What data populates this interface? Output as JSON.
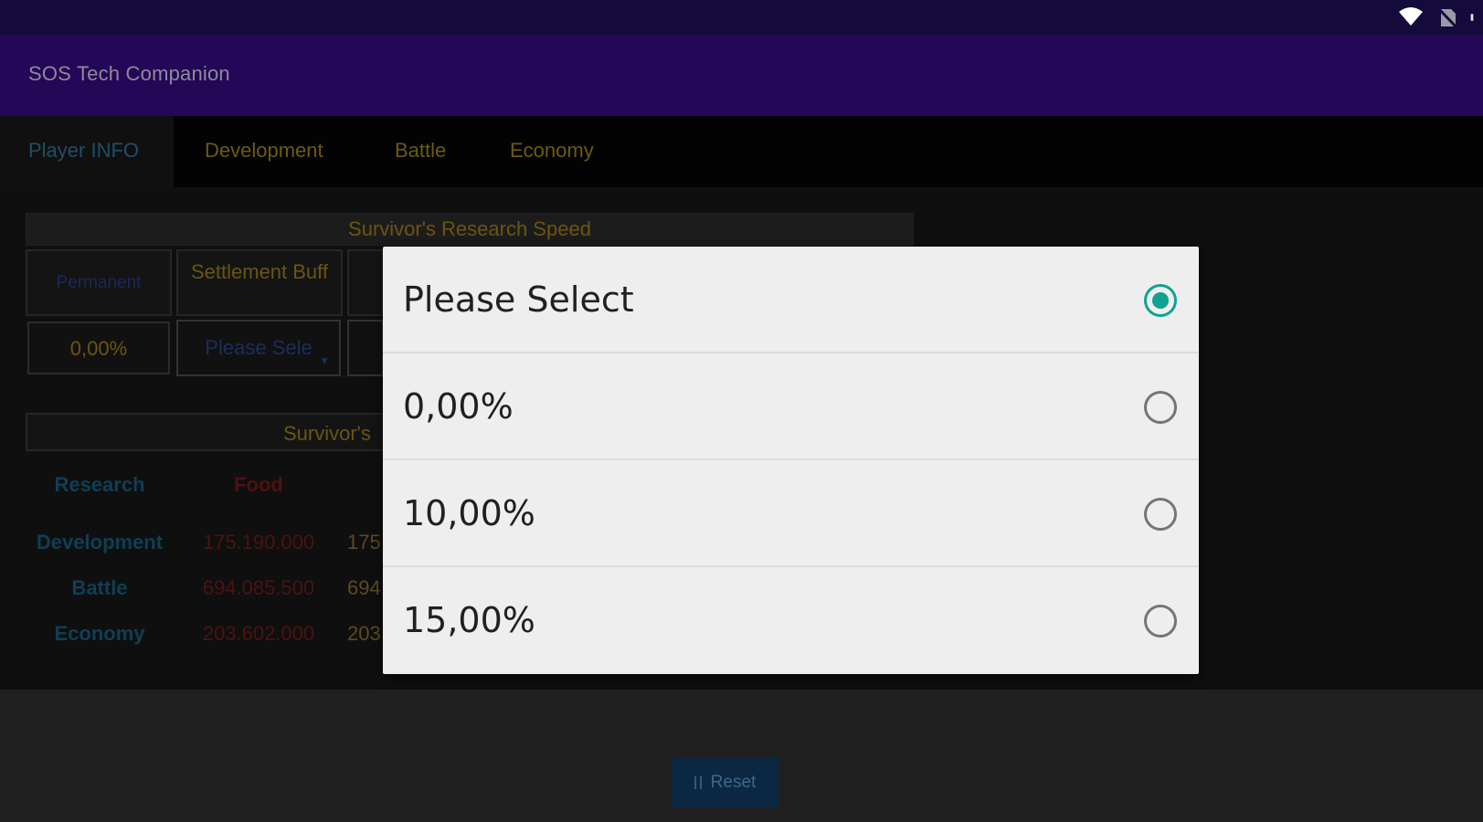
{
  "status_bar": {
    "icons": [
      "wifi-icon",
      "no-sim-icon",
      "battery-icon"
    ]
  },
  "app": {
    "title": "SOS Tech Companion"
  },
  "tabs": [
    {
      "label": "Player INFO",
      "active": true
    },
    {
      "label": "Development",
      "active": false
    },
    {
      "label": "Battle",
      "active": false
    },
    {
      "label": "Economy",
      "active": false
    }
  ],
  "research_speed": {
    "title": "Survivor's Research Speed",
    "permanent_label": "Permanent",
    "settlement_buff_label": "Settlement Buff",
    "permanent_value": "0,00%",
    "settlement_buff_value": "Please Sele"
  },
  "survivors_table": {
    "title": "Survivor's",
    "headers": {
      "research": "Research",
      "food": "Food"
    },
    "rows": [
      {
        "label": "Development",
        "food": "175.190.000",
        "extra": "175"
      },
      {
        "label": "Battle",
        "food": "694.085.500",
        "extra": "694"
      },
      {
        "label": "Economy",
        "food": "203.602.000",
        "extra": "203"
      }
    ]
  },
  "footer": {
    "reset_label": "Reset"
  },
  "dialog": {
    "options": [
      {
        "label": "Please Select",
        "selected": true
      },
      {
        "label": "0,00%",
        "selected": false
      },
      {
        "label": "10,00%",
        "selected": false
      },
      {
        "label": "15,00%",
        "selected": false
      }
    ]
  },
  "colors": {
    "status_bar": "#150a3c",
    "app_bar": "#250758",
    "radio_accent": "#0fa38f"
  }
}
